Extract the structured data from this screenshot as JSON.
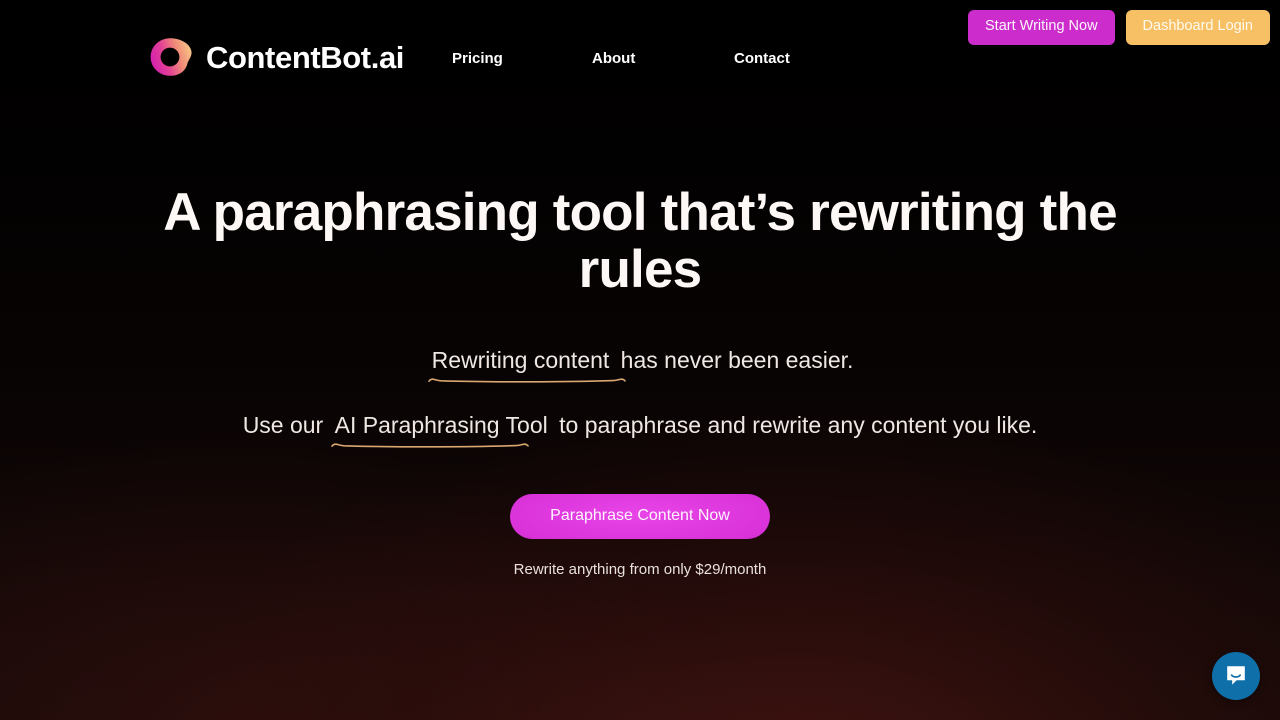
{
  "brand": {
    "name": "ContentBot.ai",
    "logo_icon": "ring-blob-logo-icon",
    "gradient_from": "#d926a9",
    "gradient_to": "#f5b97f"
  },
  "nav": {
    "items": [
      {
        "label": "Pricing"
      },
      {
        "label": "About"
      },
      {
        "label": "Contact"
      }
    ]
  },
  "header_actions": {
    "start_writing_label": "Start Writing Now",
    "start_writing_color": "#cb2ccb",
    "dashboard_login_label": "Dashboard Login",
    "dashboard_login_color": "#f7c064"
  },
  "hero": {
    "headline": "A paraphrasing tool that’s rewriting the rules",
    "sub1_highlight": "Rewriting content",
    "sub1_rest": " has never been easier.",
    "sub2_before": "Use our ",
    "sub2_highlight": "AI Paraphrasing Tool",
    "sub2_after": " to paraphrase and rewrite any content you like.",
    "highlight_underline_color": "#d9a770"
  },
  "cta": {
    "button_label": "Paraphrase Content Now",
    "button_color": "#d62fd6",
    "note": "Rewrite anything from only $29/month"
  },
  "chat": {
    "icon": "chat-bubble-smile-icon",
    "color": "#0f6fa8"
  }
}
